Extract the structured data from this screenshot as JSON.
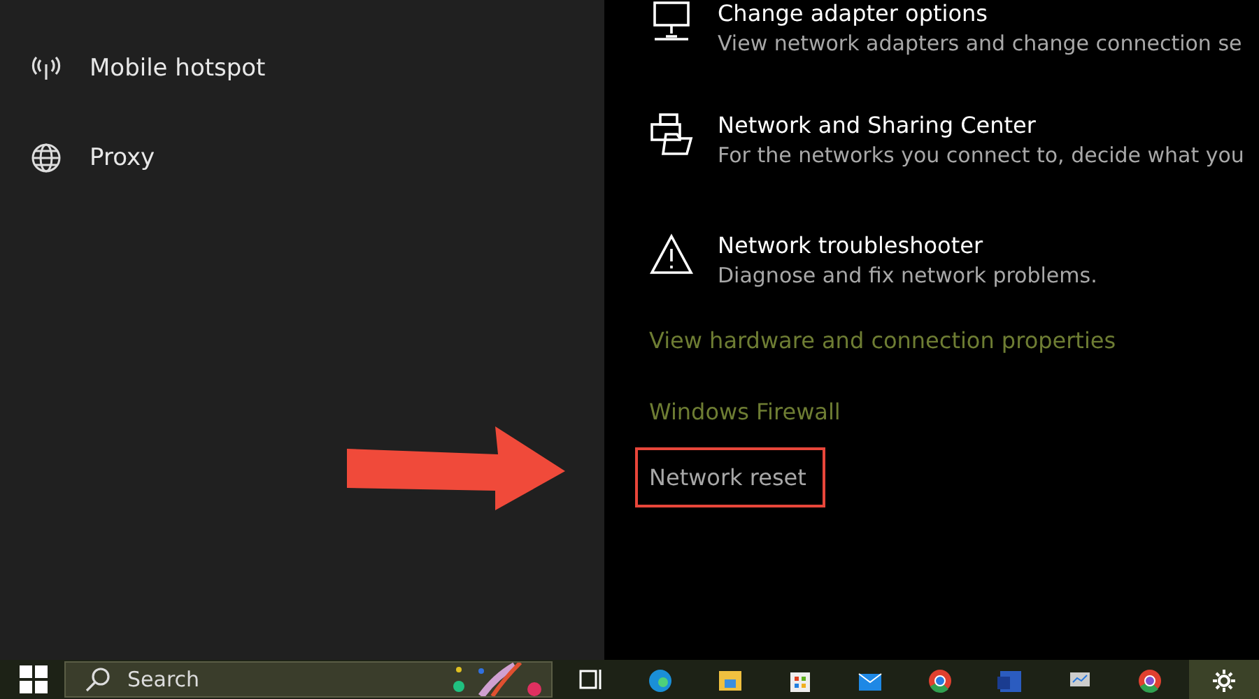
{
  "sidebar": {
    "items": [
      {
        "kind": "hotspot",
        "label": "Mobile hotspot"
      },
      {
        "kind": "globe",
        "label": "Proxy"
      }
    ]
  },
  "settings": [
    {
      "kind": "monitor",
      "title": "Change adapter options",
      "description": "View network adapters and change connection se"
    },
    {
      "kind": "sharing",
      "title": "Network and Sharing Center",
      "description": "For the networks you connect to, decide what you"
    },
    {
      "kind": "warning",
      "title": "Network troubleshooter",
      "description": "Diagnose and fix network problems."
    }
  ],
  "links": [
    {
      "kind": "accent",
      "label": "View hardware and connection properties",
      "highlighted": false
    },
    {
      "kind": "accent",
      "label": "Windows Firewall",
      "highlighted": false
    },
    {
      "kind": "plain",
      "label": "Network reset",
      "highlighted": true
    }
  ],
  "callout_arrow": true,
  "taskbar": {
    "search_placeholder": "Search",
    "apps": [
      {
        "kind": "taskview",
        "selected": false
      },
      {
        "kind": "edge",
        "selected": false
      },
      {
        "kind": "folder",
        "selected": false
      },
      {
        "kind": "store",
        "selected": false
      },
      {
        "kind": "mail",
        "selected": false
      },
      {
        "kind": "chrome",
        "selected": false
      },
      {
        "kind": "word",
        "selected": false
      },
      {
        "kind": "monitor",
        "selected": false
      },
      {
        "kind": "chrome-alt",
        "selected": false
      },
      {
        "kind": "gear",
        "selected": true
      }
    ]
  }
}
